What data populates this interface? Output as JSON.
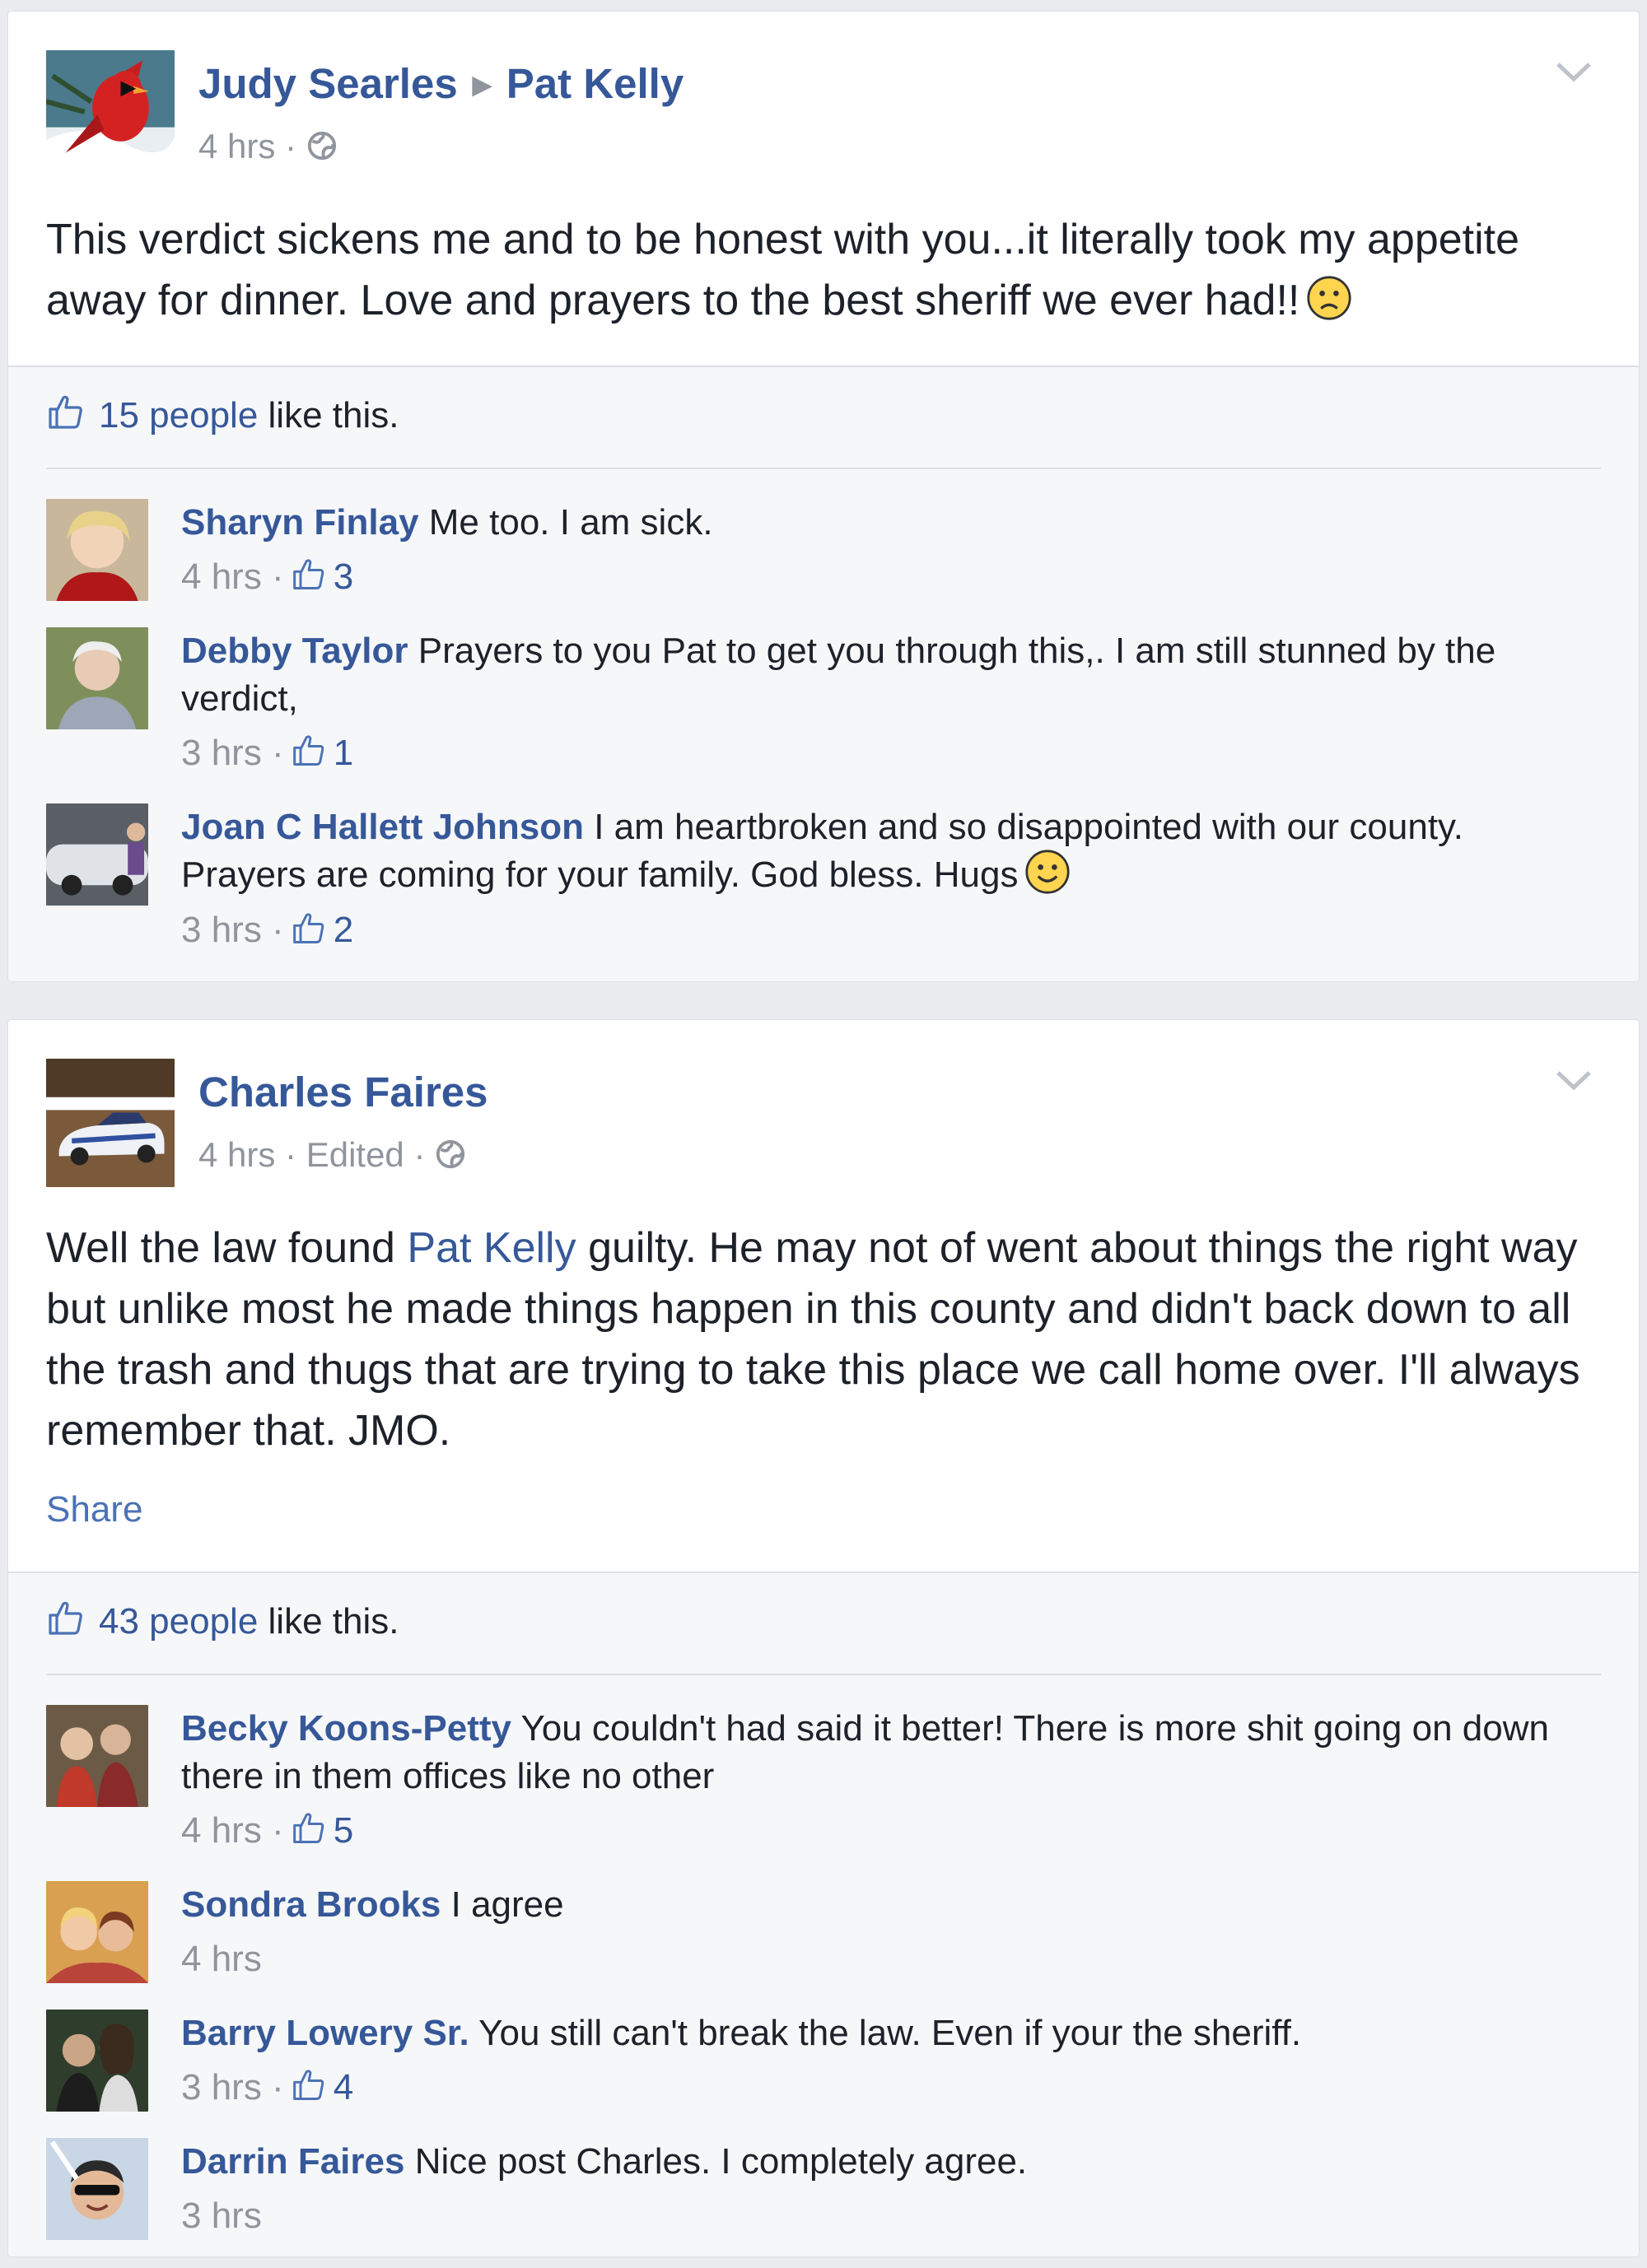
{
  "posts": [
    {
      "author": "Judy Searles",
      "target": "Pat Kelly",
      "time": "4 hrs",
      "text_lines": [
        "This verdict sickens me and to be honest with you...it literally took my appetite",
        "away for dinner. Love and prayers to the best sheriff we ever had!!"
      ],
      "likes_count": "15 people",
      "likes_suffix": " like this.",
      "comments": [
        {
          "name": "Sharyn Finlay",
          "text": "Me too. I am sick.",
          "time": "4 hrs",
          "likes": "3"
        },
        {
          "name": "Debby Taylor",
          "text": "Prayers to you Pat to get you through this,. I am still stunned by the verdict,",
          "time": "3 hrs",
          "likes": "1"
        },
        {
          "name": "Joan C Hallett Johnson",
          "text": "I am heartbroken and so disappointed with our county. Prayers are coming for your family. God bless. Hugs",
          "time": "3 hrs",
          "likes": "2"
        }
      ]
    },
    {
      "author": "Charles Faires",
      "time": "4 hrs",
      "edited": "Edited",
      "text_before_link": "Well the law found ",
      "text_link": "Pat Kelly",
      "text_after_link": " guilty. He may not of went about things the right way but unlike most he made things happen in this county and didn't back down to all the trash and thugs that are trying to take this place we call home over. I'll always remember that. JMO.",
      "share_label": "Share",
      "likes_count": "43 people",
      "likes_suffix": " like this.",
      "comments": [
        {
          "name": "Becky Koons-Petty",
          "text": "You couldn't had said it better! There is more shit going on down there in them offices like no other",
          "time": "4 hrs",
          "likes": "5"
        },
        {
          "name": "Sondra Brooks",
          "text": "I agree",
          "time": "4 hrs",
          "likes": ""
        },
        {
          "name": "Barry Lowery Sr.",
          "text": "You still can't break the law. Even if your the sheriff.",
          "time": "3 hrs",
          "likes": "4"
        },
        {
          "name": "Darrin Faires",
          "text": "Nice post Charles. I completely agree.",
          "time": "3 hrs",
          "likes": ""
        }
      ]
    }
  ],
  "colors": {
    "link": "#365899",
    "meta": "#90949c",
    "text": "#1d2129",
    "background": "#e9ebee",
    "ufi_background": "#f6f7f9"
  },
  "icons": [
    "cardinal-avatar",
    "race-car-avatar",
    "globe-icon",
    "chevron-down-icon",
    "like-icon",
    "frown-emoji-icon",
    "smile-emoji-icon"
  ]
}
